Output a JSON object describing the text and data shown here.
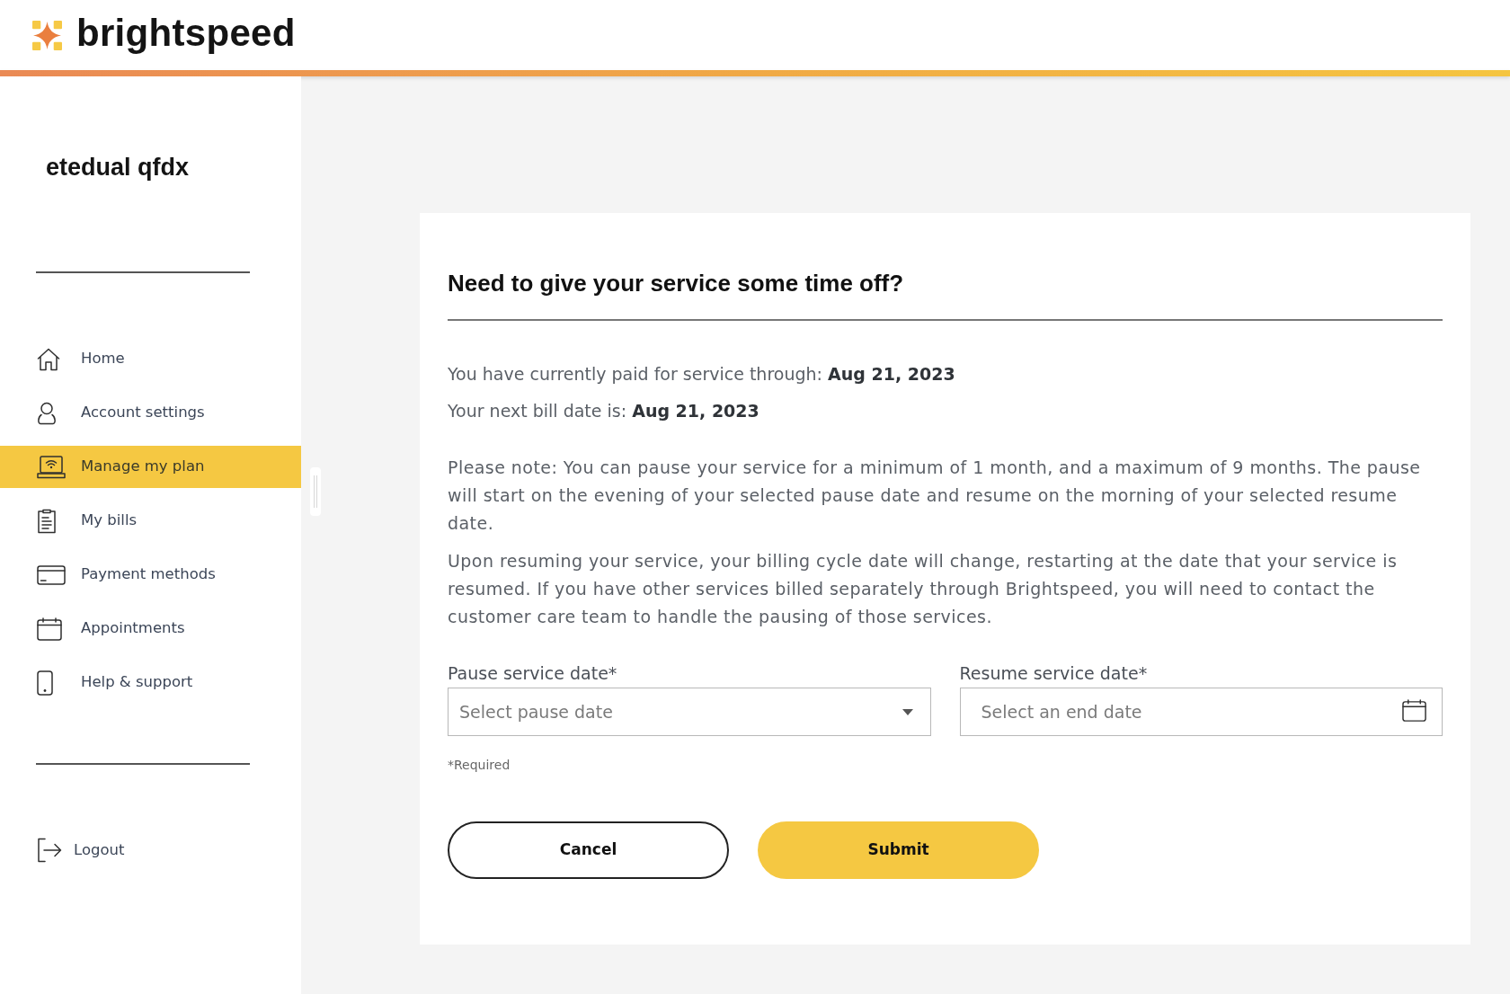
{
  "header": {
    "brand": "brightspeed"
  },
  "sidebar": {
    "user_name": "etedual qfdx",
    "items": [
      {
        "label": "Home",
        "selected": false
      },
      {
        "label": "Account settings",
        "selected": false
      },
      {
        "label": "Manage my plan",
        "selected": true
      },
      {
        "label": "My bills",
        "selected": false
      },
      {
        "label": "Payment methods",
        "selected": false
      },
      {
        "label": "Appointments",
        "selected": false
      },
      {
        "label": "Help & support",
        "selected": false
      }
    ],
    "logout": {
      "label": "Logout"
    }
  },
  "pause_form": {
    "title": "Need to give your service some time off?",
    "info": [
      "You have currently paid for service through: **Aug 21, 2023**",
      "Your next bill date is: **Aug 21, 2023**"
    ],
    "notes": [
      "Please note: You can pause your service for a minimum of 1 month, and a maximum of 9 months. The pause will start on the evening of your selected pause date and resume on the morning of your selected resume date.",
      "Upon resuming your service, your billing cycle date will change, restarting at the date that your service is resumed. If you have other services billed separately through Brightspeed, you will need to contact the customer care team to handle the pausing of those services."
    ],
    "fields": [
      {
        "kind": "dropdown",
        "label": "Pause service date*",
        "placeholder": "Select pause date"
      },
      {
        "kind": "date",
        "label": "Resume service date*",
        "placeholder": "Select an end date"
      }
    ],
    "required_note": "*Required",
    "buttons": [
      {
        "kind": "secondary",
        "label": "Cancel"
      },
      {
        "kind": "primary",
        "label": "Submit"
      }
    ]
  }
}
